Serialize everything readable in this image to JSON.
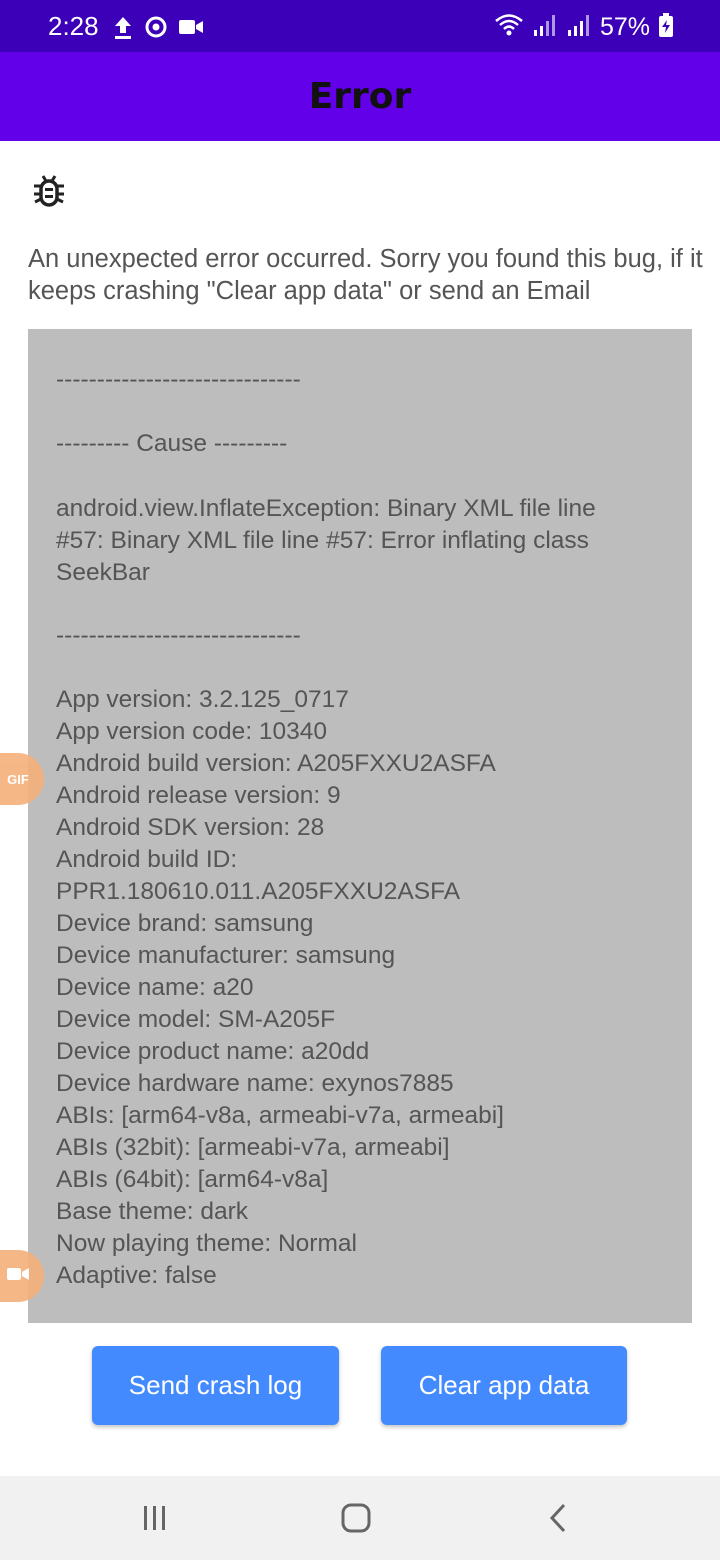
{
  "status_bar": {
    "time": "2:28",
    "battery": "57%",
    "icons": [
      "upload-icon",
      "sync-icon",
      "video-camera-icon",
      "wifi-icon",
      "signal-icon",
      "signal-icon",
      "battery-charging-icon"
    ]
  },
  "app_bar": {
    "title": "Error"
  },
  "content": {
    "icon": "bug-icon",
    "message": "An unexpected error occurred. Sorry you found this bug, if it keeps crashing \"Clear app data\" or send an Email",
    "log_lines": [
      "------------------------------",
      "--------- Cause ---------",
      "android.view.InflateException: Binary XML file line",
      "#57: Binary XML file line #57: Error inflating class",
      "SeekBar",
      "------------------------------",
      "App version: 3.2.125_0717",
      "App version code: 10340",
      "Android build version: A205FXXU2ASFA",
      "Android release version: 9",
      "Android SDK version: 28",
      "Android build ID:",
      "PPR1.180610.011.A205FXXU2ASFA",
      "Device brand: samsung",
      "Device manufacturer: samsung",
      "Device name: a20",
      "Device model: SM-A205F",
      "Device product name: a20dd",
      "Device hardware name: exynos7885",
      "ABIs: [arm64-v8a, armeabi-v7a, armeabi]",
      "ABIs (32bit): [armeabi-v7a, armeabi]",
      "ABIs (64bit): [arm64-v8a]",
      "Base theme: dark",
      "Now playing theme: Normal",
      "Adaptive: false"
    ]
  },
  "overlays": {
    "gif_label": "GIF"
  },
  "buttons": {
    "send_crash_log": "Send crash log",
    "clear_app_data": "Clear app data"
  },
  "nav_bar": {
    "items": [
      "recents-icon",
      "home-icon",
      "back-icon"
    ]
  },
  "colors": {
    "status_bar": "#3b00b8",
    "app_bar": "#6200ea",
    "log_background": "#bdbdbd",
    "button": "#448aff",
    "nav_bar": "#f1f1f1"
  }
}
